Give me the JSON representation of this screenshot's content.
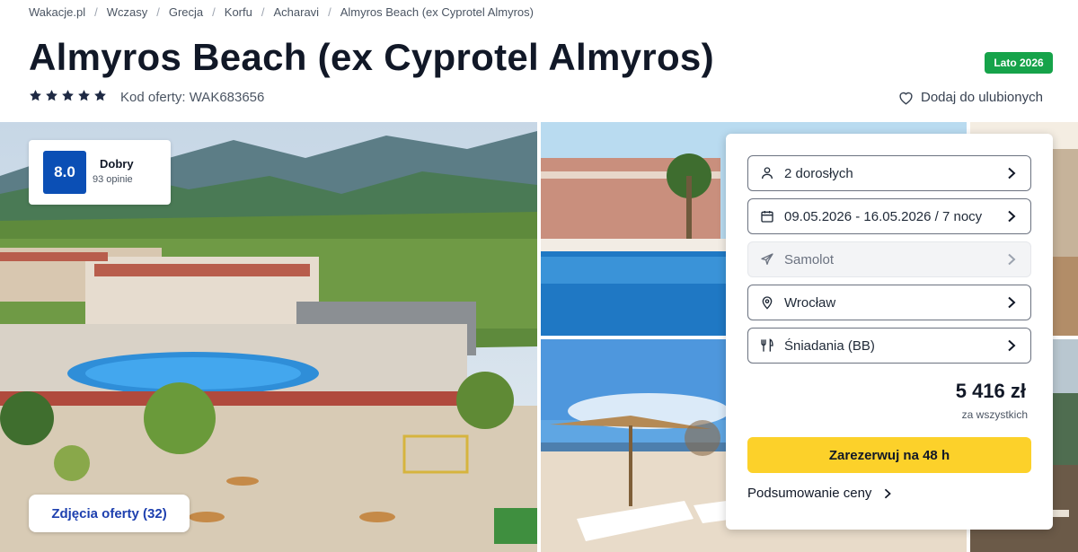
{
  "breadcrumb": [
    "Wakacje.pl",
    "Wczasy",
    "Grecja",
    "Korfu",
    "Acharavi",
    "Almyros Beach (ex Cyprotel Almyros)"
  ],
  "hotel": {
    "title": "Almyros Beach (ex Cyprotel Almyros)",
    "stars": 5,
    "offer_code": "Kod oferty: WAK683656",
    "season_badge": "Lato 2026",
    "favorite_label": "Dodaj do ulubionych"
  },
  "rating": {
    "score": "8.0",
    "label": "Dobry",
    "count": "93 opinie"
  },
  "gallery": {
    "photos_button": "Zdjęcia oferty (32)"
  },
  "booking": {
    "travelers": "2 dorosłych",
    "dates": "09.05.2026 - 16.05.2026 / 7 nocy",
    "transport": "Samolot",
    "departure": "Wrocław",
    "board": "Śniadania (BB)",
    "price": "5 416 zł",
    "price_note": "za wszystkich",
    "reserve_button": "Zarezerwuj na 48 h",
    "summary_link": "Podsumowanie ceny"
  },
  "colors": {
    "rating_blue": "#0b4fb5",
    "season_green": "#16a34a",
    "reserve_yellow": "#fcd12a",
    "link_blue": "#1e40af"
  },
  "icons": {
    "travelers": "person-icon",
    "dates": "calendar-icon",
    "transport": "plane-icon",
    "departure": "location-pin-icon",
    "board": "fork-knife-icon",
    "favorite": "heart-icon",
    "rating_star": "star-icon"
  }
}
